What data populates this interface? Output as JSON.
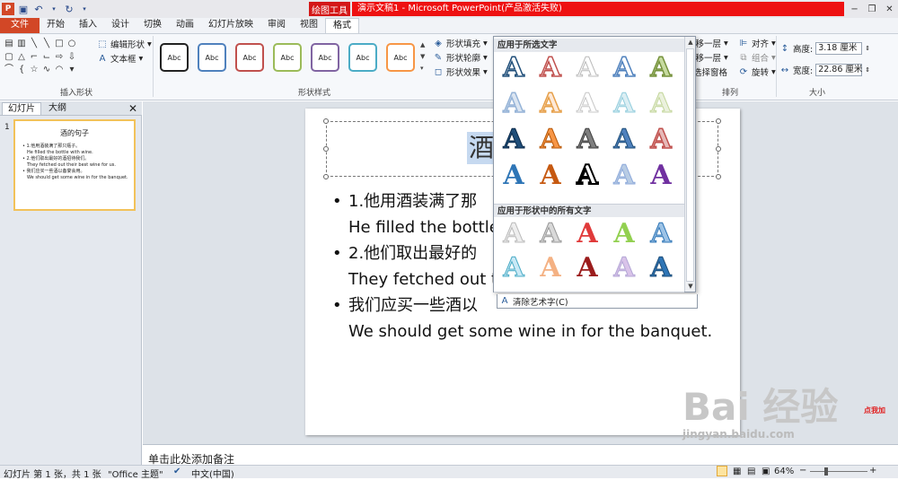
{
  "window": {
    "title": "演示文稿1 - Microsoft PowerPoint(产品激活失败)",
    "context_tab_group": "绘图工具"
  },
  "tabs": [
    "文件",
    "开始",
    "插入",
    "设计",
    "切换",
    "动画",
    "幻灯片放映",
    "审阅",
    "视图",
    "格式"
  ],
  "ribbon": {
    "insert_shapes": {
      "label": "插入形状",
      "edit_shape": "编辑形状",
      "text_box": "文本框"
    },
    "shape_styles": {
      "label": "形状样式",
      "sample": "Abc",
      "fill": "形状填充",
      "outline": "形状轮廓",
      "effects": "形状效果"
    },
    "arrange": {
      "label": "排列",
      "bring_forward": "上移一层",
      "send_backward": "下移一层",
      "selection_pane": "选择窗格",
      "align": "对齐",
      "group": "组合",
      "rotate": "旋转"
    },
    "size": {
      "label": "大小",
      "height_label": "高度:",
      "height": "3.18 厘米",
      "width_label": "宽度:",
      "width": "22.86 厘米"
    }
  },
  "gallery": {
    "section1": "应用于所选文字",
    "section2": "应用于形状中的所有文字",
    "clear": "清除艺术字(C)",
    "letter": "A"
  },
  "left_pane": {
    "tab_slides": "幻灯片",
    "tab_outline": "大纲",
    "slide_number": "1"
  },
  "thumbnail": {
    "title": "酒的句子",
    "lines": [
      "• 1.他用酒装满了那只瓶子。",
      "He filled the bottle with wine.",
      "• 2.他们取出最好的酒招待我们。",
      "They fetched out their best wine for us.",
      "• 我们应买一些酒以备宴会用。",
      "We should get some wine in for the banquet."
    ]
  },
  "slide": {
    "title_visible": "酒",
    "bullets": [
      {
        "cn": "1.他用酒装满了那",
        "en": "He filled the bottle"
      },
      {
        "cn": "2.他们取出最好的",
        "en": "They fetched out t"
      },
      {
        "cn": "我们应买一些酒以",
        "en": "We should get some wine in for the banquet."
      }
    ]
  },
  "notes_placeholder": "单击此处添加备注",
  "status": {
    "slide_info": "幻灯片 第 1 张，共 1 张",
    "theme": "\"Office 主题\"",
    "language": "中文(中国)",
    "zoom": "64%"
  },
  "watermark": {
    "brand": "Bai 经验",
    "url": "jingyan.baidu.com",
    "badge": "点我加"
  },
  "colors": {
    "file_tab": "#d24726",
    "context_red": "#ee1111",
    "selection": "#c6d9f0"
  }
}
